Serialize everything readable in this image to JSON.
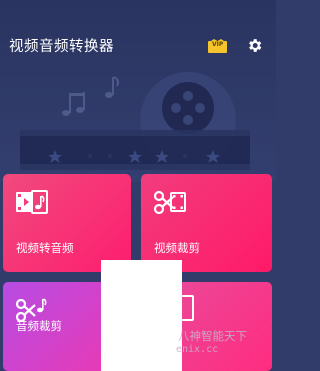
{
  "header": {
    "app_title": "视频音频转换器",
    "vip_label": "VIP",
    "vip_icon": "vip-badge-icon",
    "settings_icon": "gear-icon"
  },
  "tiles": [
    {
      "label": "视频转音频",
      "icon": "video-to-music-icon"
    },
    {
      "label": "视频裁剪",
      "icon": "video-scissors-icon"
    },
    {
      "label": "音频裁剪",
      "icon": "music-scissors-icon"
    },
    {
      "label": "",
      "icon": "partial-icon"
    }
  ],
  "watermark": {
    "text": "八神智能天下",
    "url": "enix.cc"
  },
  "colors": {
    "header_bg": "#2f3a69",
    "tile_pink": "#fe1d6e",
    "tile_purple": "#b64ce3",
    "vip_gold": "#f5c42c"
  }
}
